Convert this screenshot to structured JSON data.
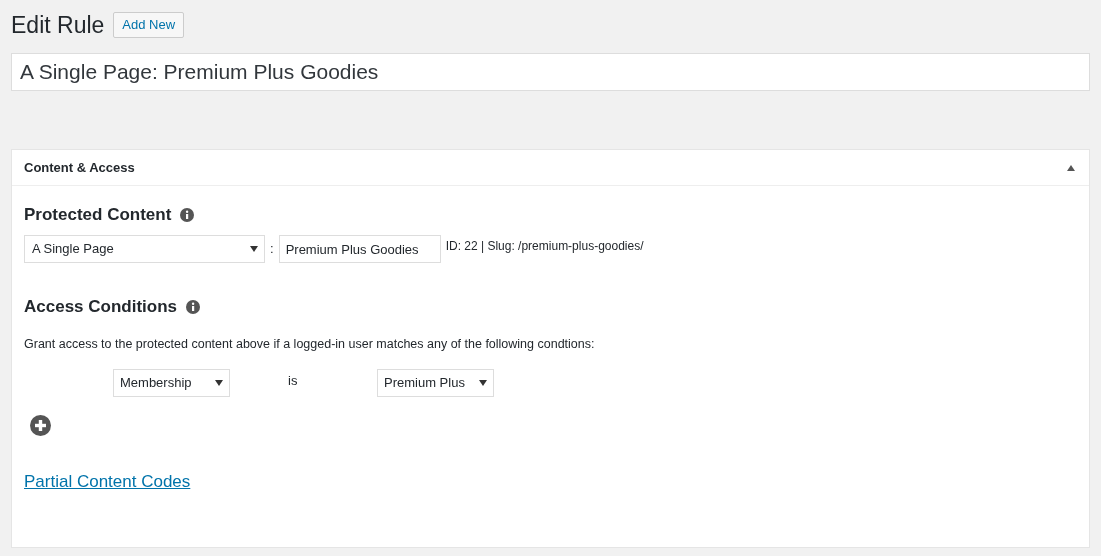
{
  "page_title": "Edit Rule",
  "add_new_button": "Add New",
  "title_field": {
    "value": "A Single Page: Premium Plus Goodies"
  },
  "panel": {
    "title": "Content & Access",
    "expanded": true,
    "protected_content": {
      "heading": "Protected Content",
      "type_select": "A Single Page",
      "separator": ":",
      "page_field": {
        "value": "Premium Plus Goodies"
      },
      "meta": "ID: 22 | Slug: /premium-plus-goodies/"
    },
    "access_conditions": {
      "heading": "Access Conditions",
      "description": "Grant access to the protected content above if a logged-in user matches any of the following condtions:",
      "conditions": [
        {
          "field": "Membership",
          "operator": "is",
          "value": "Premium Plus"
        }
      ]
    },
    "partial_content_link": "Partial Content Codes"
  }
}
